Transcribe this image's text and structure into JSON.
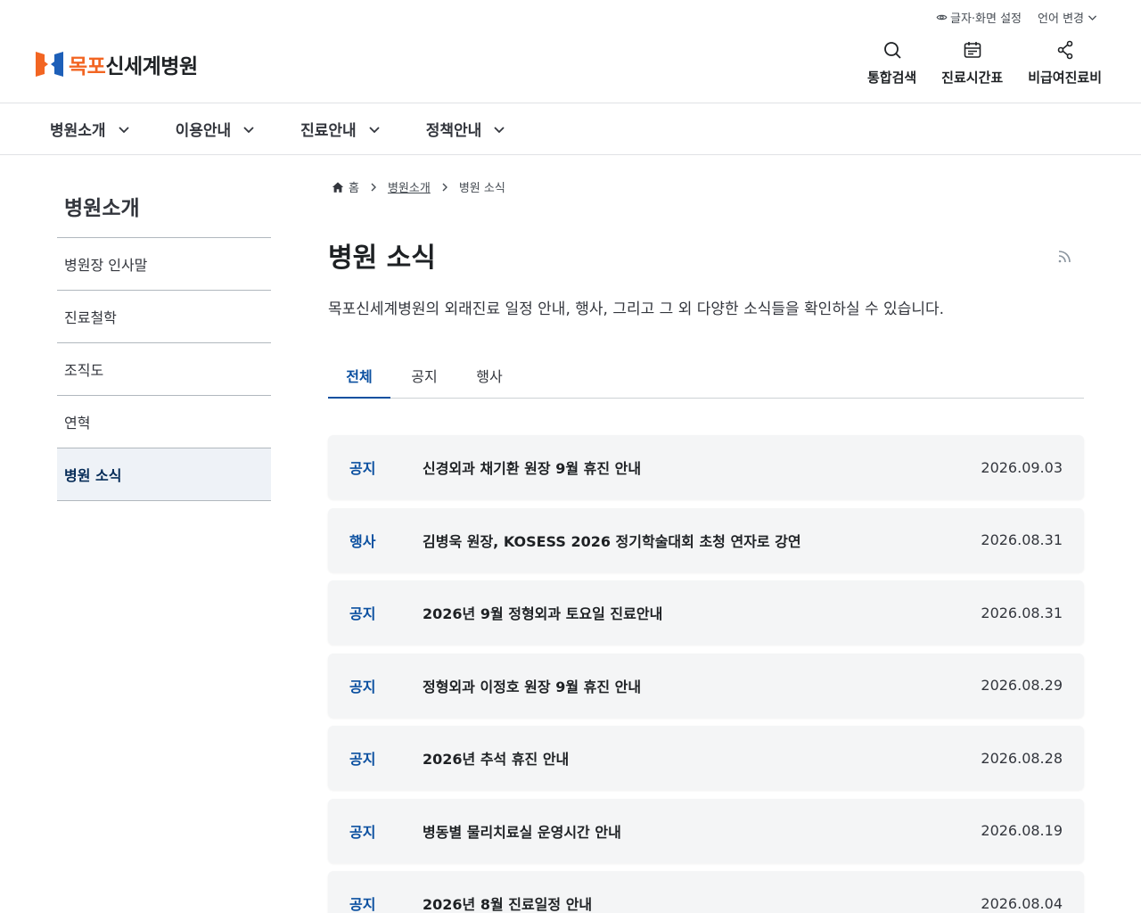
{
  "utility": {
    "text_setting": "글자·화면 설정",
    "language": "언어 변경"
  },
  "logo": {
    "part1": "목포",
    "part2": "신세계병원"
  },
  "tools": [
    {
      "label": "통합검색",
      "icon": "search-icon"
    },
    {
      "label": "진료시간표",
      "icon": "calendar-icon"
    },
    {
      "label": "비급여진료비",
      "icon": "route-icon"
    }
  ],
  "gnb": [
    "병원소개",
    "이용안내",
    "진료안내",
    "정책안내"
  ],
  "sidebar": {
    "title": "병원소개",
    "items": [
      {
        "label": "병원장 인사말"
      },
      {
        "label": "진료철학"
      },
      {
        "label": "조직도"
      },
      {
        "label": "연혁"
      },
      {
        "label": "병원 소식"
      }
    ]
  },
  "breadcrumb": {
    "home": "홈",
    "level1": "병원소개",
    "current": "병원 소식"
  },
  "page": {
    "title": "병원 소식",
    "description": "목포신세계병원의 외래진료 일정 안내, 행사, 그리고 그 외 다양한 소식들을 확인하실 수 있습니다."
  },
  "tabs": [
    "전체",
    "공지",
    "행사"
  ],
  "colors": {
    "accent": "#0b50a0",
    "brand_orange": "#f26522",
    "row_bg": "#f4f5f6"
  },
  "posts": [
    {
      "category": "공지",
      "title": "신경외과 채기환 원장 9월 휴진 안내",
      "date": "2026.09.03"
    },
    {
      "category": "행사",
      "title": "김병욱 원장, KOSESS 2026 정기학술대회 초청 연자로 강연",
      "date": "2026.08.31"
    },
    {
      "category": "공지",
      "title": "2026년 9월 정형외과 토요일 진료안내",
      "date": "2026.08.31"
    },
    {
      "category": "공지",
      "title": "정형외과 이정호 원장 9월 휴진 안내",
      "date": "2026.08.29"
    },
    {
      "category": "공지",
      "title": "2026년 추석 휴진 안내",
      "date": "2026.08.28"
    },
    {
      "category": "공지",
      "title": "병동별 물리치료실 운영시간 안내",
      "date": "2026.08.19"
    },
    {
      "category": "공지",
      "title": "2026년 8월 진료일정 안내",
      "date": "2026.08.04"
    }
  ]
}
